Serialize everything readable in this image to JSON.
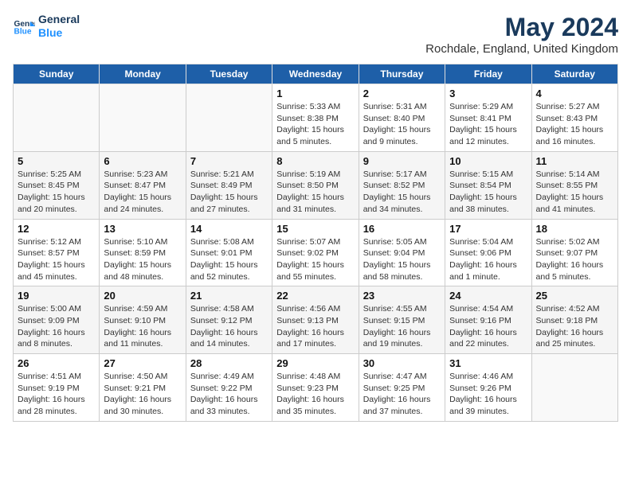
{
  "header": {
    "logo_line1": "General",
    "logo_line2": "Blue",
    "title": "May 2024",
    "subtitle": "Rochdale, England, United Kingdom"
  },
  "days_of_week": [
    "Sunday",
    "Monday",
    "Tuesday",
    "Wednesday",
    "Thursday",
    "Friday",
    "Saturday"
  ],
  "weeks": [
    [
      {
        "date": "",
        "content": ""
      },
      {
        "date": "",
        "content": ""
      },
      {
        "date": "",
        "content": ""
      },
      {
        "date": "1",
        "content": "Sunrise: 5:33 AM\nSunset: 8:38 PM\nDaylight: 15 hours\nand 5 minutes."
      },
      {
        "date": "2",
        "content": "Sunrise: 5:31 AM\nSunset: 8:40 PM\nDaylight: 15 hours\nand 9 minutes."
      },
      {
        "date": "3",
        "content": "Sunrise: 5:29 AM\nSunset: 8:41 PM\nDaylight: 15 hours\nand 12 minutes."
      },
      {
        "date": "4",
        "content": "Sunrise: 5:27 AM\nSunset: 8:43 PM\nDaylight: 15 hours\nand 16 minutes."
      }
    ],
    [
      {
        "date": "5",
        "content": "Sunrise: 5:25 AM\nSunset: 8:45 PM\nDaylight: 15 hours\nand 20 minutes."
      },
      {
        "date": "6",
        "content": "Sunrise: 5:23 AM\nSunset: 8:47 PM\nDaylight: 15 hours\nand 24 minutes."
      },
      {
        "date": "7",
        "content": "Sunrise: 5:21 AM\nSunset: 8:49 PM\nDaylight: 15 hours\nand 27 minutes."
      },
      {
        "date": "8",
        "content": "Sunrise: 5:19 AM\nSunset: 8:50 PM\nDaylight: 15 hours\nand 31 minutes."
      },
      {
        "date": "9",
        "content": "Sunrise: 5:17 AM\nSunset: 8:52 PM\nDaylight: 15 hours\nand 34 minutes."
      },
      {
        "date": "10",
        "content": "Sunrise: 5:15 AM\nSunset: 8:54 PM\nDaylight: 15 hours\nand 38 minutes."
      },
      {
        "date": "11",
        "content": "Sunrise: 5:14 AM\nSunset: 8:55 PM\nDaylight: 15 hours\nand 41 minutes."
      }
    ],
    [
      {
        "date": "12",
        "content": "Sunrise: 5:12 AM\nSunset: 8:57 PM\nDaylight: 15 hours\nand 45 minutes."
      },
      {
        "date": "13",
        "content": "Sunrise: 5:10 AM\nSunset: 8:59 PM\nDaylight: 15 hours\nand 48 minutes."
      },
      {
        "date": "14",
        "content": "Sunrise: 5:08 AM\nSunset: 9:01 PM\nDaylight: 15 hours\nand 52 minutes."
      },
      {
        "date": "15",
        "content": "Sunrise: 5:07 AM\nSunset: 9:02 PM\nDaylight: 15 hours\nand 55 minutes."
      },
      {
        "date": "16",
        "content": "Sunrise: 5:05 AM\nSunset: 9:04 PM\nDaylight: 15 hours\nand 58 minutes."
      },
      {
        "date": "17",
        "content": "Sunrise: 5:04 AM\nSunset: 9:06 PM\nDaylight: 16 hours\nand 1 minute."
      },
      {
        "date": "18",
        "content": "Sunrise: 5:02 AM\nSunset: 9:07 PM\nDaylight: 16 hours\nand 5 minutes."
      }
    ],
    [
      {
        "date": "19",
        "content": "Sunrise: 5:00 AM\nSunset: 9:09 PM\nDaylight: 16 hours\nand 8 minutes."
      },
      {
        "date": "20",
        "content": "Sunrise: 4:59 AM\nSunset: 9:10 PM\nDaylight: 16 hours\nand 11 minutes."
      },
      {
        "date": "21",
        "content": "Sunrise: 4:58 AM\nSunset: 9:12 PM\nDaylight: 16 hours\nand 14 minutes."
      },
      {
        "date": "22",
        "content": "Sunrise: 4:56 AM\nSunset: 9:13 PM\nDaylight: 16 hours\nand 17 minutes."
      },
      {
        "date": "23",
        "content": "Sunrise: 4:55 AM\nSunset: 9:15 PM\nDaylight: 16 hours\nand 19 minutes."
      },
      {
        "date": "24",
        "content": "Sunrise: 4:54 AM\nSunset: 9:16 PM\nDaylight: 16 hours\nand 22 minutes."
      },
      {
        "date": "25",
        "content": "Sunrise: 4:52 AM\nSunset: 9:18 PM\nDaylight: 16 hours\nand 25 minutes."
      }
    ],
    [
      {
        "date": "26",
        "content": "Sunrise: 4:51 AM\nSunset: 9:19 PM\nDaylight: 16 hours\nand 28 minutes."
      },
      {
        "date": "27",
        "content": "Sunrise: 4:50 AM\nSunset: 9:21 PM\nDaylight: 16 hours\nand 30 minutes."
      },
      {
        "date": "28",
        "content": "Sunrise: 4:49 AM\nSunset: 9:22 PM\nDaylight: 16 hours\nand 33 minutes."
      },
      {
        "date": "29",
        "content": "Sunrise: 4:48 AM\nSunset: 9:23 PM\nDaylight: 16 hours\nand 35 minutes."
      },
      {
        "date": "30",
        "content": "Sunrise: 4:47 AM\nSunset: 9:25 PM\nDaylight: 16 hours\nand 37 minutes."
      },
      {
        "date": "31",
        "content": "Sunrise: 4:46 AM\nSunset: 9:26 PM\nDaylight: 16 hours\nand 39 minutes."
      },
      {
        "date": "",
        "content": ""
      }
    ]
  ]
}
